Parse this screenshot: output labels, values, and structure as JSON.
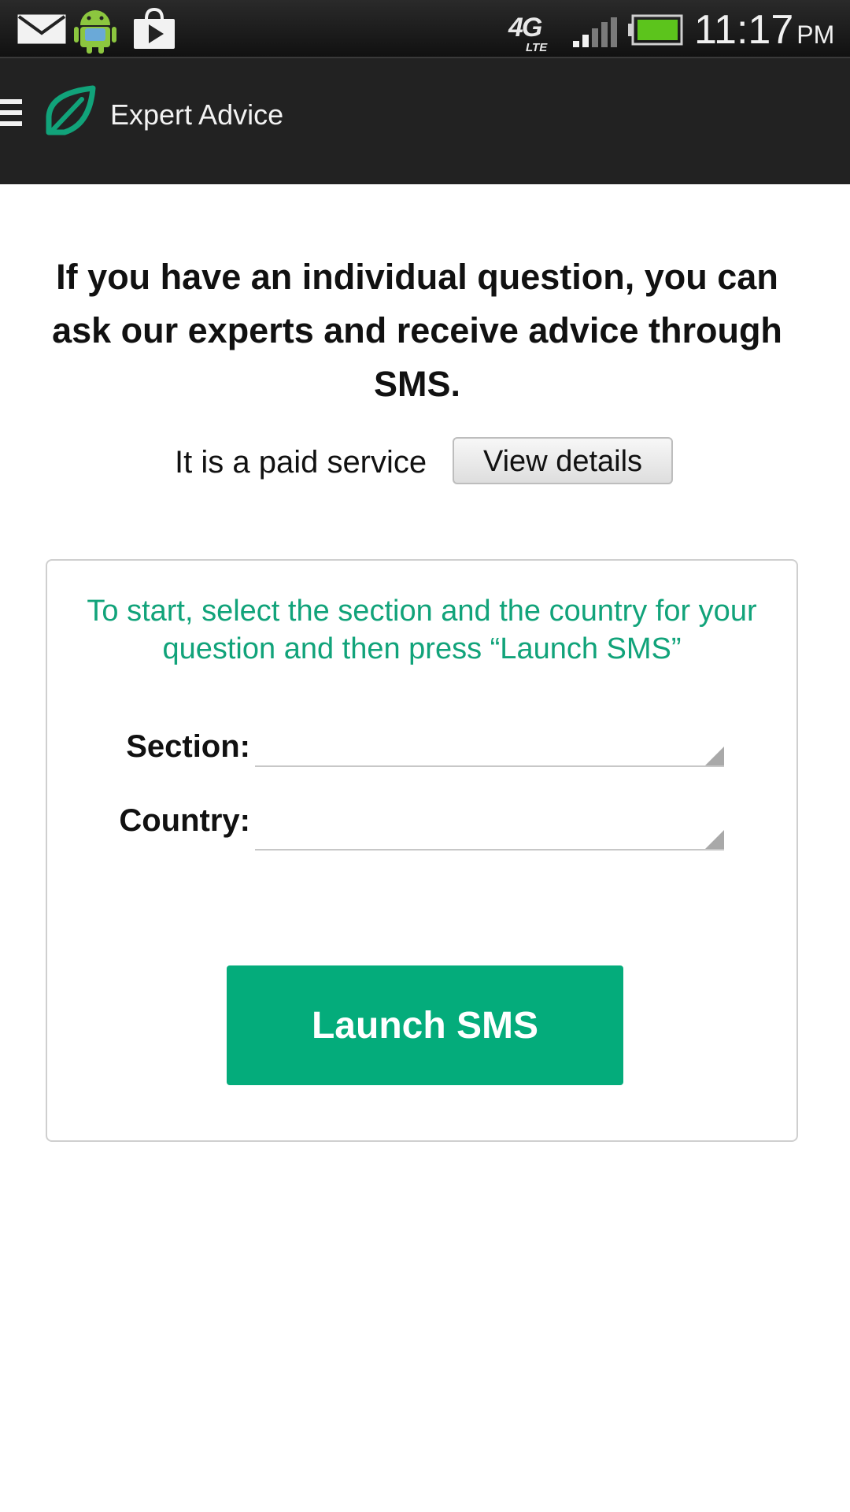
{
  "status_bar": {
    "time": "11:17",
    "ampm": "PM",
    "network": "4G",
    "network_sub": "LTE",
    "icons": [
      "mail-icon",
      "android-icon",
      "play-store-icon",
      "signal-icon",
      "battery-icon"
    ]
  },
  "app_bar": {
    "title": "Expert Advice",
    "icons": [
      "menu-icon",
      "leaf-icon"
    ]
  },
  "main": {
    "headline": "If you have an individual question, you can ask our experts and receive advice through SMS.",
    "paid_text": "It is a paid service",
    "view_details_label": "View details"
  },
  "card": {
    "instructions": "To start, select the section and the country for your question and then press “Launch SMS”",
    "section_label": "Section:",
    "section_value": "",
    "country_label": "Country:",
    "country_value": "",
    "launch_label": "Launch SMS"
  },
  "colors": {
    "accent": "#04ac7b",
    "instruction_text": "#11a37a",
    "app_bar": "#222222"
  }
}
